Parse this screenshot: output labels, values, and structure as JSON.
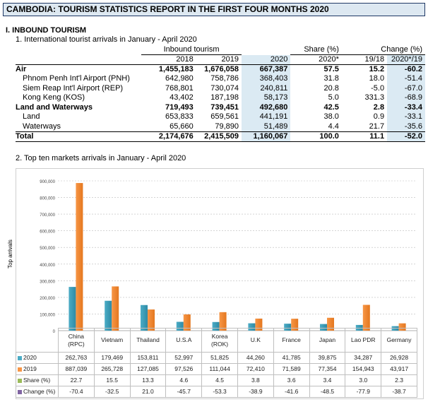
{
  "banner": "CAMBODIA: TOURISM STATISTICS REPORT IN THE FIRST FOUR MONTHS 2020",
  "section": "I.  INBOUND TOURISM",
  "subtitle1": "1. International tourist arrivals in January - April 2020",
  "subtitle2": "2. Top ten markets arrivals in January - April 2020",
  "table": {
    "group_inbound": "Inbound tourism",
    "group_share": "Share (%)",
    "group_change": "Change (%)",
    "col_2018": "2018",
    "col_2019": "2019",
    "col_2020": "2020",
    "col_share": "2020*",
    "col_ch1": "19/18",
    "col_ch2": "2020*/19",
    "rows": [
      {
        "label": "Air",
        "v2018": "1,455,183",
        "v2019": "1,676,058",
        "v2020": "667,387",
        "share": "57.5",
        "ch1": "15.2",
        "ch2": "-60.2"
      },
      {
        "label": "Phnom Penh Int'l Airport (PNH)",
        "v2018": "642,980",
        "v2019": "758,786",
        "v2020": "368,403",
        "share": "31.8",
        "ch1": "18.0",
        "ch2": "-51.4"
      },
      {
        "label": "Siem Reap Int'l Airport (REP)",
        "v2018": "768,801",
        "v2019": "730,074",
        "v2020": "240,811",
        "share": "20.8",
        "ch1": "-5.0",
        "ch2": "-67.0"
      },
      {
        "label": "Kong Keng (KOS)",
        "v2018": "43,402",
        "v2019": "187,198",
        "v2020": "58,173",
        "share": "5.0",
        "ch1": "331.3",
        "ch2": "-68.9"
      },
      {
        "label": "Land and Waterways",
        "v2018": "719,493",
        "v2019": "739,451",
        "v2020": "492,680",
        "share": "42.5",
        "ch1": "2.8",
        "ch2": "-33.4"
      },
      {
        "label": "Land",
        "v2018": "653,833",
        "v2019": "659,561",
        "v2020": "441,191",
        "share": "38.0",
        "ch1": "0.9",
        "ch2": "-33.1"
      },
      {
        "label": "Waterways",
        "v2018": "65,660",
        "v2019": "79,890",
        "v2020": "51,489",
        "share": "4.4",
        "ch1": "21.7",
        "ch2": "-35.6"
      },
      {
        "label": "Total",
        "v2018": "2,174,676",
        "v2019": "2,415,509",
        "v2020": "1,160,067",
        "share": "100.0",
        "ch1": "11.1",
        "ch2": "-52.0"
      }
    ]
  },
  "colors": {
    "s2020": "#4bacc6",
    "s2019": "#f79646",
    "share": "#9bbb59",
    "change": "#8064a2"
  },
  "chart_data": {
    "type": "bar",
    "ylabel": "Top arrivals",
    "ylim": [
      0,
      900000
    ],
    "yticks": [
      "0",
      "100,000",
      "200,000",
      "300,000",
      "400,000",
      "500,000",
      "600,000",
      "700,000",
      "800,000",
      "900,000"
    ],
    "categories": [
      "China (RPC)",
      "Vietnam",
      "Thailand",
      "U.S.A",
      "Korea (ROK)",
      "U.K",
      "France",
      "Japan",
      "Lao PDR",
      "Germany"
    ],
    "category_lines": [
      [
        "China",
        "(RPC)"
      ],
      [
        "Vietnam"
      ],
      [
        "Thailand"
      ],
      [
        "U.S.A"
      ],
      [
        "Korea",
        "(ROK)"
      ],
      [
        "U.K"
      ],
      [
        "France"
      ],
      [
        "Japan"
      ],
      [
        "Lao PDR"
      ],
      [
        "Germany"
      ]
    ],
    "series": [
      {
        "name": "2020",
        "values": [
          262763,
          179469,
          153811,
          52997,
          51825,
          44260,
          41785,
          39875,
          34287,
          26928
        ],
        "labels": [
          "262,763",
          "179,469",
          "153,811",
          "52,997",
          "51,825",
          "44,260",
          "41,785",
          "39,875",
          "34,287",
          "26,928"
        ]
      },
      {
        "name": "2019",
        "values": [
          887039,
          265728,
          127085,
          97526,
          111044,
          72410,
          71589,
          77354,
          154943,
          43917
        ],
        "labels": [
          "887,039",
          "265,728",
          "127,085",
          "97,526",
          "111,044",
          "72,410",
          "71,589",
          "77,354",
          "154,943",
          "43,917"
        ]
      }
    ],
    "rows_extra": [
      {
        "name": "Share (%)",
        "labels": [
          "22.7",
          "15.5",
          "13.3",
          "4.6",
          "4.5",
          "3.8",
          "3.6",
          "3.4",
          "3.0",
          "2.3"
        ]
      },
      {
        "name": "Change (%)",
        "labels": [
          "-70.4",
          "-32.5",
          "21.0",
          "-45.7",
          "-53.3",
          "-38.9",
          "-41.6",
          "-48.5",
          "-77.9",
          "-38.7"
        ]
      }
    ]
  }
}
